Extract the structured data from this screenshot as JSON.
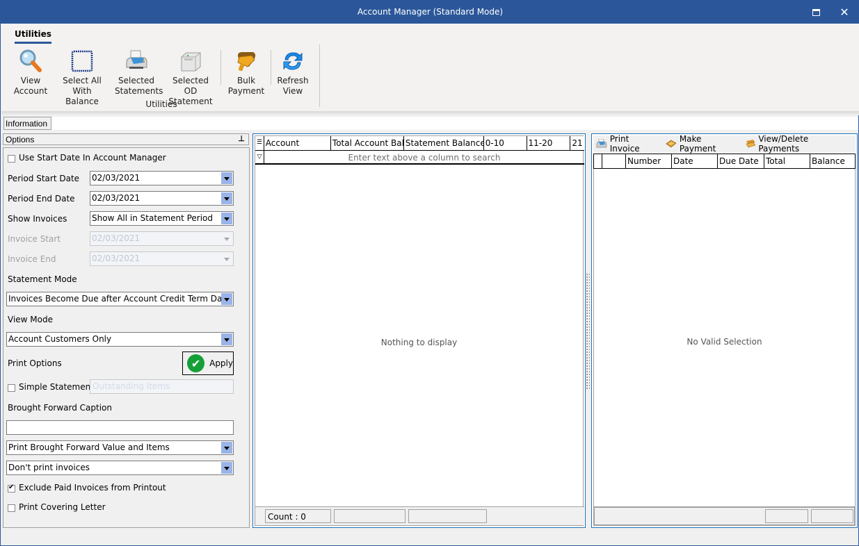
{
  "window": {
    "title": "Account Manager (Standard Mode)",
    "maximize_icon": "maximize-icon",
    "close_icon": "close-icon"
  },
  "ribbon": {
    "tab": "Utilities",
    "group_label": "Utilities",
    "buttons": [
      {
        "line1": "View",
        "line2": "Account",
        "icon": "magnifier-icon"
      },
      {
        "line1": "Select All",
        "line2": "With Balance",
        "icon": "select-all-icon"
      },
      {
        "line1": "Selected",
        "line2": "Statements",
        "icon": "printer-icon"
      },
      {
        "line1": "Selected OD",
        "line2": "Statement",
        "icon": "laser-printer-icon"
      },
      {
        "line1": "Bulk",
        "line2": "Payment",
        "icon": "wallet-icon"
      },
      {
        "line1": "Refresh",
        "line2": "View",
        "icon": "refresh-icon"
      }
    ]
  },
  "info_tab": "Information",
  "options": {
    "header": "Options",
    "use_start_date": {
      "label": "Use Start Date In Account Manager",
      "checked": false
    },
    "period_start": {
      "label": "Period Start Date",
      "value": "02/03/2021"
    },
    "period_end": {
      "label": "Period End Date",
      "value": "02/03/2021"
    },
    "show_invoices": {
      "label": "Show Invoices",
      "value": "Show All in Statement Period"
    },
    "invoice_start": {
      "label": "Invoice Start",
      "value": "02/03/2021",
      "disabled": true
    },
    "invoice_end": {
      "label": "Invoice End",
      "value": "02/03/2021",
      "disabled": true
    },
    "statement_mode": {
      "label": "Statement Mode",
      "value": "Invoices Become Due after Account Credit Term Days"
    },
    "view_mode": {
      "label": "View Mode",
      "value": "Account Customers Only"
    },
    "print_options_label": "Print Options",
    "apply_label": "Apply",
    "simple_statement": {
      "label": "Simple Statement",
      "checked": false,
      "text": "Outstanding Items"
    },
    "brought_forward_caption": {
      "label": "Brought Forward Caption",
      "value": ""
    },
    "brought_forward_mode": "Print Brought Forward Value and Items",
    "print_invoices_mode": "Don't print invoices",
    "exclude_paid": {
      "label": "Exclude Paid Invoices from Printout",
      "checked": true
    },
    "covering_letter": {
      "label": "Print Covering Letter",
      "checked": false
    }
  },
  "accounts_grid": {
    "columns": [
      "Account",
      "Total Account Bal...",
      "Statement Balance",
      "0-10",
      "11-20",
      "21"
    ],
    "filter_placeholder": "Enter text above a column to search",
    "empty_message": "Nothing to display",
    "footer": {
      "count": "Count : 0",
      "cell2": "",
      "cell3": ""
    }
  },
  "invoice_panel": {
    "toolbar": [
      {
        "label": "Print Invoice",
        "icon": "printer-icon"
      },
      {
        "label": "Make Payment",
        "icon": "payment-icon"
      },
      {
        "label": "View/Delete Payments",
        "icon": "payments-list-icon"
      }
    ],
    "columns": [
      "",
      "",
      "Number",
      "Date",
      "Due Date",
      "Total",
      "Balance"
    ],
    "empty_message": "No Valid Selection"
  }
}
